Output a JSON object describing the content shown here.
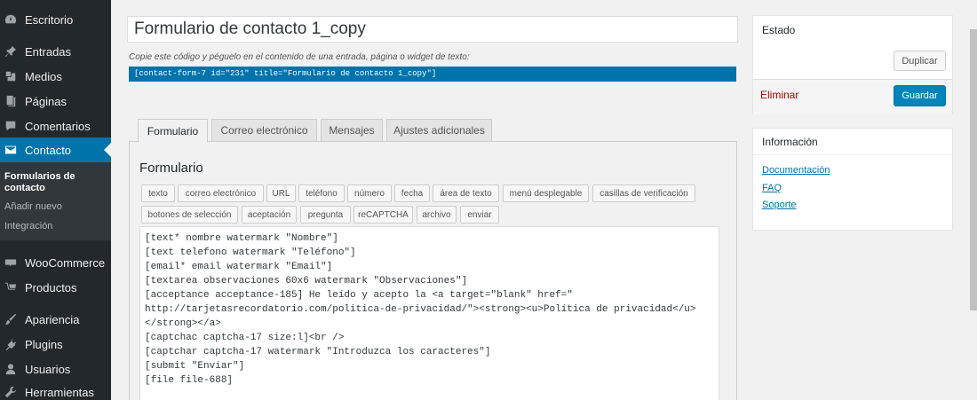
{
  "sidebar": {
    "items": [
      {
        "label": "Escritorio",
        "icon": "dashboard-icon"
      },
      {
        "label": "Entradas",
        "icon": "pin-icon"
      },
      {
        "label": "Medios",
        "icon": "media-icon"
      },
      {
        "label": "Páginas",
        "icon": "pages-icon"
      },
      {
        "label": "Comentarios",
        "icon": "comments-icon"
      },
      {
        "label": "Contacto",
        "icon": "mail-icon"
      },
      {
        "label": "WooCommerce",
        "icon": "woocommerce-icon"
      },
      {
        "label": "Productos",
        "icon": "cart-icon"
      },
      {
        "label": "Apariencia",
        "icon": "brush-icon"
      },
      {
        "label": "Plugins",
        "icon": "plugin-icon"
      },
      {
        "label": "Usuarios",
        "icon": "user-icon"
      },
      {
        "label": "Herramientas",
        "icon": "wrench-icon"
      }
    ],
    "submenu": [
      "Formularios de contacto",
      "Añadir nuevo",
      "Integración"
    ]
  },
  "editor": {
    "title_value": "Formulario de contacto 1_copy",
    "shortcode_hint": "Copie este código y péguelo en el contenido de una entrada, página o widget de texto:",
    "shortcode": "[contact-form-7 id=\"231\" title=\"Formulario de contacto 1_copy\"]"
  },
  "tabs": [
    "Formulario",
    "Correo electrónico",
    "Mensajes",
    "Ajustes adicionales"
  ],
  "form_panel": {
    "heading": "Formulario",
    "tag_buttons": [
      "texto",
      "correo electrónico",
      "URL",
      "teléfono",
      "número",
      "fecha",
      "área de texto",
      "menú desplegable",
      "casillas de verificación",
      "botones de selección",
      "aceptación",
      "pregunta",
      "reCAPTCHA",
      "archivo",
      "enviar"
    ],
    "code": "[text* nombre watermark \"Nombre\"]\n[text telefono watermark \"Teléfono\"]\n[email* email watermark \"Email\"]\n[textarea observaciones 60x6 watermark \"Observaciones\"]\n[acceptance acceptance-185] He leído y acepto la <a target=\"blank\" href=\"\nhttp://tarjetasrecordatorio.com/politica-de-privacidad/\"><strong><u>Política de privacidad</u>\n</strong></a>\n[captchac captcha-17 size:l]<br />\n[captchar captcha-17 watermark \"Introduzca los caracteres\"]\n[submit \"Enviar\"]\n[file file-688]"
  },
  "status_box": {
    "title": "Estado",
    "duplicate_label": "Duplicar",
    "delete_label": "Eliminar",
    "save_label": "Guardar"
  },
  "info_box": {
    "title": "Información",
    "links": [
      "Documentación",
      "FAQ",
      "Soporte"
    ]
  },
  "colors": {
    "admin_blue": "#0073aa",
    "sidebar_bg": "#23282d",
    "delete_red": "#a00"
  }
}
